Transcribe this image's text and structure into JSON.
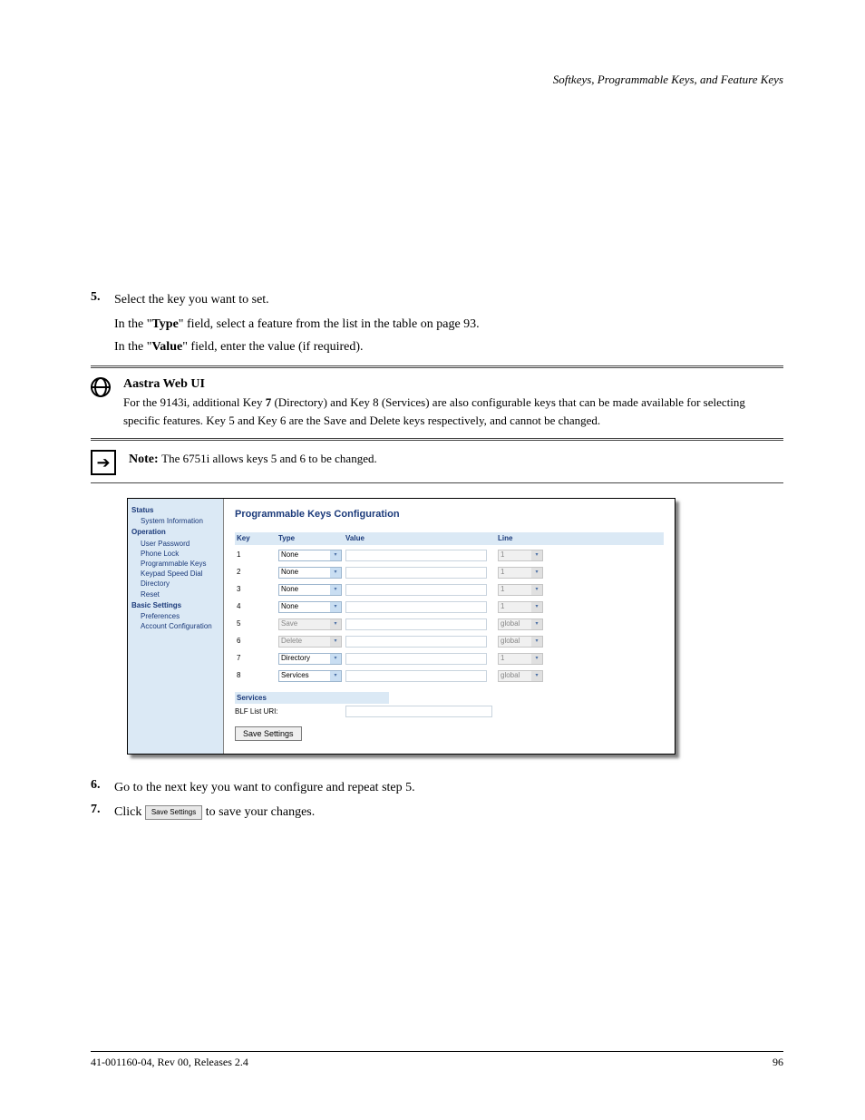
{
  "breadcrumb": "Softkeys, Programmable Keys, and Feature Keys",
  "step5": {
    "n": "5.",
    "text_a": "Select the key you want to set.",
    "bullet1_prefix": "In the \"",
    "bullet1_field": "Type",
    "bullet1_suffix": "\" field, select a feature from the list in the table on page 93.",
    "bullet2_prefix": "In the \"",
    "bullet2_field": "Value",
    "bullet2_suffix": "\" field, enter the value (if required)."
  },
  "callout_web": {
    "title": "Aastra Web UI",
    "text_before": "For the 9143i, additional Key ",
    "text_bold": "7",
    "text_after": " (Directory) and Key 8 (Services) are also configurable keys that can be made available for selecting specific features. Key 5 and Key 6 are the Save and Delete keys respectively, and cannot be changed."
  },
  "callout_note": {
    "title": "Note:",
    "body": "The 6751i allows keys 5 and 6 to be changed."
  },
  "shot": {
    "title": "Programmable Keys Configuration",
    "headers": {
      "key": "Key",
      "type": "Type",
      "value": "Value",
      "line": "Line"
    },
    "rows": [
      {
        "key": "1",
        "type": "None",
        "type_enabled": true,
        "line": "1",
        "line_enabled": false
      },
      {
        "key": "2",
        "type": "None",
        "type_enabled": true,
        "line": "1",
        "line_enabled": false
      },
      {
        "key": "3",
        "type": "None",
        "type_enabled": true,
        "line": "1",
        "line_enabled": false
      },
      {
        "key": "4",
        "type": "None",
        "type_enabled": true,
        "line": "1",
        "line_enabled": false
      },
      {
        "key": "5",
        "type": "Save",
        "type_enabled": false,
        "line": "global",
        "line_enabled": false
      },
      {
        "key": "6",
        "type": "Delete",
        "type_enabled": false,
        "line": "global",
        "line_enabled": false
      },
      {
        "key": "7",
        "type": "Directory",
        "type_enabled": true,
        "line": "1",
        "line_enabled": false
      },
      {
        "key": "8",
        "type": "Services",
        "type_enabled": true,
        "line": "global",
        "line_enabled": false
      }
    ],
    "services_hdr": "Services",
    "blf_label": "BLF List URI:",
    "save_btn": "Save Settings",
    "sidebar": {
      "status_hdr": "Status",
      "status_items": [
        "System Information"
      ],
      "operation_hdr": "Operation",
      "operation_items": [
        "User Password",
        "Phone Lock",
        "Programmable Keys",
        "Keypad Speed Dial",
        "Directory",
        "Reset"
      ],
      "basic_hdr": "Basic Settings",
      "basic_items": [
        "Preferences",
        "Account Configuration"
      ]
    }
  },
  "step6": {
    "n": "6.",
    "text": "Go to the next key you want to configure and repeat step 5."
  },
  "step7": {
    "n": "7.",
    "prefix": "Click ",
    "btn": "Save Settings",
    "suffix": " to save your changes."
  },
  "footer": {
    "left": "41-001160-04, Rev 00, Releases 2.4",
    "right": "96"
  }
}
